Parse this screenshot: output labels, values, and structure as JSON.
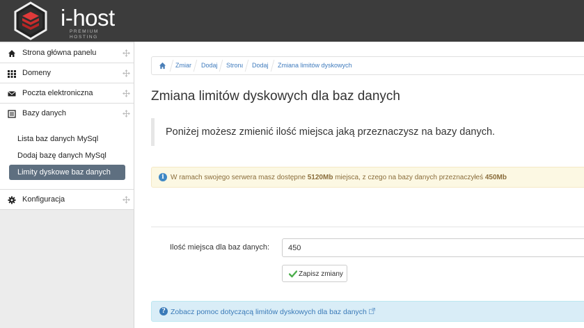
{
  "brand": {
    "name": "i-host",
    "tagline": "PREMIUM HOSTING"
  },
  "colors": {
    "header_bg": "#3c3c3c",
    "logo_red": "#e03a3a",
    "sidebar_active": "#5e6f80",
    "link": "#3f7bbd"
  },
  "sidebar": {
    "items": [
      {
        "label": "Strona główna panelu",
        "icon": "home-icon"
      },
      {
        "label": "Domeny",
        "icon": "grid-icon"
      },
      {
        "label": "Poczta elektroniczna",
        "icon": "envelope-icon"
      },
      {
        "label": "Bazy danych",
        "icon": "list-icon"
      },
      {
        "label": "Konfiguracja",
        "icon": "gear-icon"
      }
    ],
    "submenu": [
      {
        "label": "Lista baz danych MySql"
      },
      {
        "label": "Dodaj bazę danych MySql"
      },
      {
        "label": "Limity dyskowe baz danych",
        "active": true
      }
    ]
  },
  "breadcrumb": {
    "items": [
      "Zmiar",
      "Dodaj",
      "Strona",
      "Dodaj",
      "Zmiana limitów dyskowych"
    ]
  },
  "page": {
    "title": "Zmiana limitów dyskowych dla baz danych",
    "lead": "Poniżej możesz zmienić ilość miejsca jaką przeznaczysz na bazy danych."
  },
  "notice": {
    "prefix": "W ramach swojego serwera masz dostępne ",
    "total": "5120Mb",
    "middle": " miejsca, z czego na bazy danych przeznaczyłeś ",
    "used": "450Mb"
  },
  "form": {
    "label": "Ilość miejsca dla baz danych:",
    "value": "450",
    "save_label": "Zapisz zmiany"
  },
  "help": {
    "text": "Zobacz pomoc dotyczącą limitów dyskowych dla baz danych"
  }
}
